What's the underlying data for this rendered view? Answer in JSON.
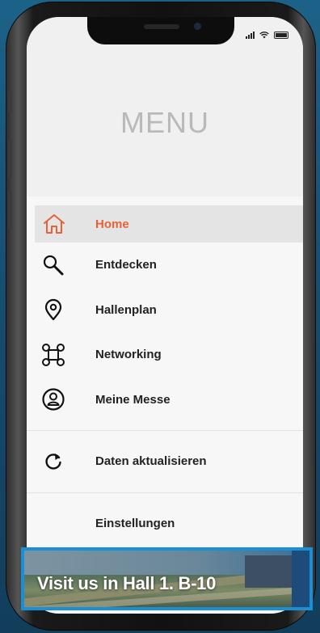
{
  "menu": {
    "title": "MENU",
    "items": [
      {
        "label": "Home",
        "icon": "home-icon",
        "active": true
      },
      {
        "label": "Entdecken",
        "icon": "search-icon"
      },
      {
        "label": "Hallenplan",
        "icon": "location-pin-icon"
      },
      {
        "label": "Networking",
        "icon": "network-icon"
      },
      {
        "label": "Meine Messe",
        "icon": "user-circle-icon"
      }
    ],
    "refresh": {
      "label": "Daten aktualisieren",
      "icon": "refresh-icon"
    },
    "settings": {
      "label": "Einstellungen"
    }
  },
  "banner": {
    "text": "Visit us in Hall 1. B-10"
  },
  "colors": {
    "accent": "#e8613a",
    "banner_border": "#1a8fd6"
  }
}
